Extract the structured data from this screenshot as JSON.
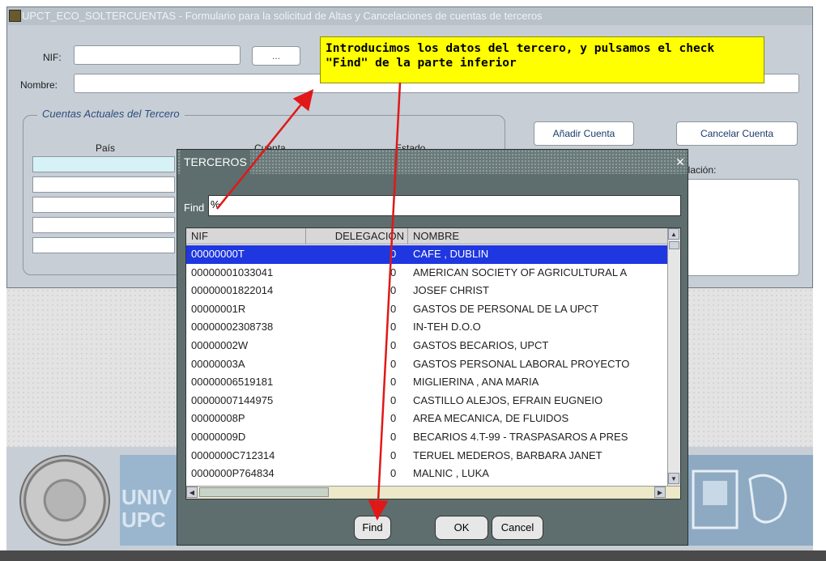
{
  "main_window": {
    "title": "UPCT_ECO_SOLTERCUENTAS - Formulario para la solicitud de Altas y Cancelaciones de cuentas de terceros",
    "nif_label": "NIF:",
    "lov_button": "...",
    "nombre_label": "Nombre:",
    "group_title": "Cuentas Actuales del Tercero",
    "columns": {
      "pais": "País",
      "cuenta": "Cuenta",
      "estado": "Estado"
    },
    "add_account_button": "Añadir Cuenta",
    "cancel_account_button": "Cancelar Cuenta",
    "cancel_reason_label": "elación:"
  },
  "annotation": {
    "text": "Introducimos los datos del tercero, y pulsamos el check \"Find\" de la parte inferior"
  },
  "banner": {
    "text_line1": "UNIV",
    "text_line2": "UPC"
  },
  "dialog": {
    "title": "TERCEROS",
    "find_label": "Find",
    "find_value": "%",
    "headers": {
      "nif": "NIF",
      "delegacion": "DELEGACIÓN",
      "nombre": "NOMBRE"
    },
    "rows": [
      {
        "nif": "00000000T",
        "delegacion": "0",
        "nombre": "CAFE , DUBLIN",
        "selected": true
      },
      {
        "nif": "00000001033041",
        "delegacion": "0",
        "nombre": "AMERICAN SOCIETY OF AGRICULTURAL A"
      },
      {
        "nif": "00000001822014",
        "delegacion": "0",
        "nombre": "JOSEF CHRIST"
      },
      {
        "nif": "00000001R",
        "delegacion": "0",
        "nombre": "GASTOS DE PERSONAL DE LA UPCT"
      },
      {
        "nif": "00000002308738",
        "delegacion": "0",
        "nombre": "IN-TEH D.O.O"
      },
      {
        "nif": "00000002W",
        "delegacion": "0",
        "nombre": "GASTOS BECARIOS, UPCT"
      },
      {
        "nif": "00000003A",
        "delegacion": "0",
        "nombre": "GASTOS PERSONAL LABORAL PROYECTO"
      },
      {
        "nif": "00000006519181",
        "delegacion": "0",
        "nombre": "MIGLIERINA , ANA MARIA"
      },
      {
        "nif": "00000007144975",
        "delegacion": "0",
        "nombre": "CASTILLO ALEJOS, EFRAIN EUGNEIO"
      },
      {
        "nif": "00000008P",
        "delegacion": "0",
        "nombre": "AREA MECANICA, DE FLUIDOS"
      },
      {
        "nif": "00000009D",
        "delegacion": "0",
        "nombre": "BECARIOS 4.T-99 - TRASPASAROS A PRES"
      },
      {
        "nif": "0000000C712314",
        "delegacion": "0",
        "nombre": "TERUEL MEDEROS, BARBARA JANET"
      },
      {
        "nif": "0000000P764834",
        "delegacion": "0",
        "nombre": "MALNIC , LUKA"
      }
    ],
    "find_button": "Find",
    "ok_button": "OK",
    "cancel_button": "Cancel"
  },
  "colors": {
    "selection": "#1f37e0",
    "annotation": "#ffff00",
    "arrow": "#e01818"
  }
}
